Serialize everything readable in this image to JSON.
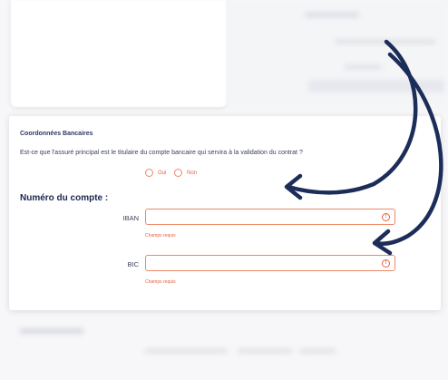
{
  "section": {
    "title": "Coordonnées Bancaires",
    "question": "Est-ce que l'assuré principal est le titulaire du compte bancaire qui servira à la validation du contrat ?",
    "options": [
      {
        "label": "Oui"
      },
      {
        "label": "Non"
      }
    ]
  },
  "account": {
    "title": "Numéro du compte :",
    "iban": {
      "label": "IBAN",
      "value": "",
      "error": "Champs requis",
      "error_icon": "!"
    },
    "bic": {
      "label": "BIC",
      "value": "",
      "error": "Champs requis",
      "error_icon": "!"
    }
  },
  "colors": {
    "accent": "#e8623d",
    "title": "#1b2550",
    "arrow": "#1d2d5a"
  },
  "icons": [
    "exclamation-circle-icon",
    "curved-arrow-icon"
  ]
}
